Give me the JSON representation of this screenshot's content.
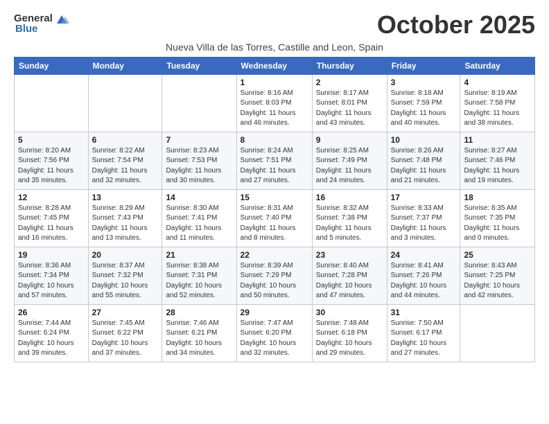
{
  "header": {
    "logo_general": "General",
    "logo_blue": "Blue",
    "month_title": "October 2025",
    "subtitle": "Nueva Villa de las Torres, Castille and Leon, Spain"
  },
  "weekdays": [
    "Sunday",
    "Monday",
    "Tuesday",
    "Wednesday",
    "Thursday",
    "Friday",
    "Saturday"
  ],
  "weeks": [
    [
      {
        "day": "",
        "info": ""
      },
      {
        "day": "",
        "info": ""
      },
      {
        "day": "",
        "info": ""
      },
      {
        "day": "1",
        "info": "Sunrise: 8:16 AM\nSunset: 8:03 PM\nDaylight: 11 hours\nand 46 minutes."
      },
      {
        "day": "2",
        "info": "Sunrise: 8:17 AM\nSunset: 8:01 PM\nDaylight: 11 hours\nand 43 minutes."
      },
      {
        "day": "3",
        "info": "Sunrise: 8:18 AM\nSunset: 7:59 PM\nDaylight: 11 hours\nand 40 minutes."
      },
      {
        "day": "4",
        "info": "Sunrise: 8:19 AM\nSunset: 7:58 PM\nDaylight: 11 hours\nand 38 minutes."
      }
    ],
    [
      {
        "day": "5",
        "info": "Sunrise: 8:20 AM\nSunset: 7:56 PM\nDaylight: 11 hours\nand 35 minutes."
      },
      {
        "day": "6",
        "info": "Sunrise: 8:22 AM\nSunset: 7:54 PM\nDaylight: 11 hours\nand 32 minutes."
      },
      {
        "day": "7",
        "info": "Sunrise: 8:23 AM\nSunset: 7:53 PM\nDaylight: 11 hours\nand 30 minutes."
      },
      {
        "day": "8",
        "info": "Sunrise: 8:24 AM\nSunset: 7:51 PM\nDaylight: 11 hours\nand 27 minutes."
      },
      {
        "day": "9",
        "info": "Sunrise: 8:25 AM\nSunset: 7:49 PM\nDaylight: 11 hours\nand 24 minutes."
      },
      {
        "day": "10",
        "info": "Sunrise: 8:26 AM\nSunset: 7:48 PM\nDaylight: 11 hours\nand 21 minutes."
      },
      {
        "day": "11",
        "info": "Sunrise: 8:27 AM\nSunset: 7:46 PM\nDaylight: 11 hours\nand 19 minutes."
      }
    ],
    [
      {
        "day": "12",
        "info": "Sunrise: 8:28 AM\nSunset: 7:45 PM\nDaylight: 11 hours\nand 16 minutes."
      },
      {
        "day": "13",
        "info": "Sunrise: 8:29 AM\nSunset: 7:43 PM\nDaylight: 11 hours\nand 13 minutes."
      },
      {
        "day": "14",
        "info": "Sunrise: 8:30 AM\nSunset: 7:41 PM\nDaylight: 11 hours\nand 11 minutes."
      },
      {
        "day": "15",
        "info": "Sunrise: 8:31 AM\nSunset: 7:40 PM\nDaylight: 11 hours\nand 8 minutes."
      },
      {
        "day": "16",
        "info": "Sunrise: 8:32 AM\nSunset: 7:38 PM\nDaylight: 11 hours\nand 5 minutes."
      },
      {
        "day": "17",
        "info": "Sunrise: 8:33 AM\nSunset: 7:37 PM\nDaylight: 11 hours\nand 3 minutes."
      },
      {
        "day": "18",
        "info": "Sunrise: 8:35 AM\nSunset: 7:35 PM\nDaylight: 11 hours\nand 0 minutes."
      }
    ],
    [
      {
        "day": "19",
        "info": "Sunrise: 8:36 AM\nSunset: 7:34 PM\nDaylight: 10 hours\nand 57 minutes."
      },
      {
        "day": "20",
        "info": "Sunrise: 8:37 AM\nSunset: 7:32 PM\nDaylight: 10 hours\nand 55 minutes."
      },
      {
        "day": "21",
        "info": "Sunrise: 8:38 AM\nSunset: 7:31 PM\nDaylight: 10 hours\nand 52 minutes."
      },
      {
        "day": "22",
        "info": "Sunrise: 8:39 AM\nSunset: 7:29 PM\nDaylight: 10 hours\nand 50 minutes."
      },
      {
        "day": "23",
        "info": "Sunrise: 8:40 AM\nSunset: 7:28 PM\nDaylight: 10 hours\nand 47 minutes."
      },
      {
        "day": "24",
        "info": "Sunrise: 8:41 AM\nSunset: 7:26 PM\nDaylight: 10 hours\nand 44 minutes."
      },
      {
        "day": "25",
        "info": "Sunrise: 8:43 AM\nSunset: 7:25 PM\nDaylight: 10 hours\nand 42 minutes."
      }
    ],
    [
      {
        "day": "26",
        "info": "Sunrise: 7:44 AM\nSunset: 6:24 PM\nDaylight: 10 hours\nand 39 minutes."
      },
      {
        "day": "27",
        "info": "Sunrise: 7:45 AM\nSunset: 6:22 PM\nDaylight: 10 hours\nand 37 minutes."
      },
      {
        "day": "28",
        "info": "Sunrise: 7:46 AM\nSunset: 6:21 PM\nDaylight: 10 hours\nand 34 minutes."
      },
      {
        "day": "29",
        "info": "Sunrise: 7:47 AM\nSunset: 6:20 PM\nDaylight: 10 hours\nand 32 minutes."
      },
      {
        "day": "30",
        "info": "Sunrise: 7:48 AM\nSunset: 6:18 PM\nDaylight: 10 hours\nand 29 minutes."
      },
      {
        "day": "31",
        "info": "Sunrise: 7:50 AM\nSunset: 6:17 PM\nDaylight: 10 hours\nand 27 minutes."
      },
      {
        "day": "",
        "info": ""
      }
    ]
  ]
}
